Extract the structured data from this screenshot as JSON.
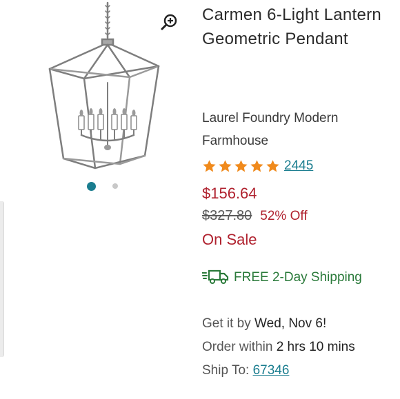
{
  "product": {
    "title": "Carmen 6-Light Lantern Geometric Pendant",
    "brand": "Laurel Foundry Modern Farmhouse",
    "rating": 5,
    "review_count": "2445",
    "price": "$156.64",
    "original_price": "$327.80",
    "discount": "52% Off",
    "sale_label": "On Sale"
  },
  "shipping": {
    "label": "FREE 2-Day Shipping",
    "get_it_by_prefix": "Get it by ",
    "get_it_by_date": "Wed, Nov 6!",
    "order_within_prefix": "Order within ",
    "order_within_time": "2 hrs 10 mins",
    "ship_to_prefix": "Ship To: ",
    "ship_to_zip": "67346"
  },
  "gallery": {
    "image_count": 2,
    "active_index": 1
  },
  "colors": {
    "accent": "#1a7d8f",
    "sale": "#b0222f",
    "shipping": "#2a7a3a",
    "star": "#f08a1c"
  },
  "icons": [
    "zoom-in-icon",
    "star-icon",
    "truck-icon"
  ]
}
